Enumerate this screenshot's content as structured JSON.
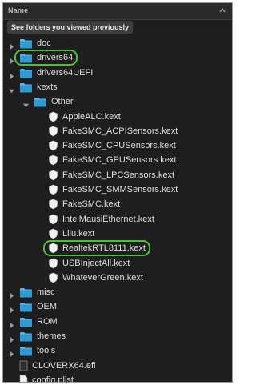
{
  "header": {
    "label": "Name"
  },
  "hint": {
    "label": "See folders you viewed previously"
  },
  "tree": [
    {
      "label": "doc",
      "icon": "folder-icon",
      "expanded": false,
      "depth": 0
    },
    {
      "label": "drivers64",
      "icon": "folder-icon",
      "expanded": false,
      "depth": 0,
      "highlighted": true
    },
    {
      "label": "drivers64UEFI",
      "icon": "folder-icon",
      "expanded": false,
      "depth": 0
    },
    {
      "label": "kexts",
      "icon": "folder-icon",
      "expanded": true,
      "depth": 0
    },
    {
      "label": "Other",
      "icon": "folder-icon",
      "expanded": true,
      "depth": 1
    },
    {
      "label": "AppleALC.kext",
      "icon": "kext-icon",
      "depth": 2
    },
    {
      "label": "FakeSMC_ACPISensors.kext",
      "icon": "kext-icon",
      "depth": 2
    },
    {
      "label": "FakeSMC_CPUSensors.kext",
      "icon": "kext-icon",
      "depth": 2
    },
    {
      "label": "FakeSMC_GPUSensors.kext",
      "icon": "kext-icon",
      "depth": 2
    },
    {
      "label": "FakeSMC_LPCSensors.kext",
      "icon": "kext-icon",
      "depth": 2
    },
    {
      "label": "FakeSMC_SMMSensors.kext",
      "icon": "kext-icon",
      "depth": 2
    },
    {
      "label": "FakeSMC.kext",
      "icon": "kext-icon",
      "depth": 2
    },
    {
      "label": "IntelMausiEthernet.kext",
      "icon": "kext-icon",
      "depth": 2
    },
    {
      "label": "Lilu.kext",
      "icon": "kext-icon",
      "depth": 2
    },
    {
      "label": "RealtekRTL8111.kext",
      "icon": "kext-icon",
      "depth": 2,
      "highlighted": true
    },
    {
      "label": "USBInjectAll.kext",
      "icon": "kext-icon",
      "depth": 2
    },
    {
      "label": "WhateverGreen.kext",
      "icon": "kext-icon",
      "depth": 2
    },
    {
      "label": "misc",
      "icon": "folder-icon",
      "expanded": false,
      "depth": 0
    },
    {
      "label": "OEM",
      "icon": "folder-icon",
      "expanded": false,
      "depth": 0
    },
    {
      "label": "ROM",
      "icon": "folder-icon",
      "expanded": false,
      "depth": 0
    },
    {
      "label": "themes",
      "icon": "folder-icon",
      "expanded": false,
      "depth": 0
    },
    {
      "label": "tools",
      "icon": "folder-icon",
      "expanded": false,
      "depth": 0
    },
    {
      "label": "CLOVERX64.efi",
      "icon": "file-icon",
      "depth": 0
    },
    {
      "label": "config.plist",
      "icon": "document-icon",
      "depth": 0
    }
  ],
  "colors": {
    "background": "#1e1e1e",
    "folder": "#2d9bd6",
    "text": "#dcdcdc",
    "highlight": "#4fbf3a"
  }
}
